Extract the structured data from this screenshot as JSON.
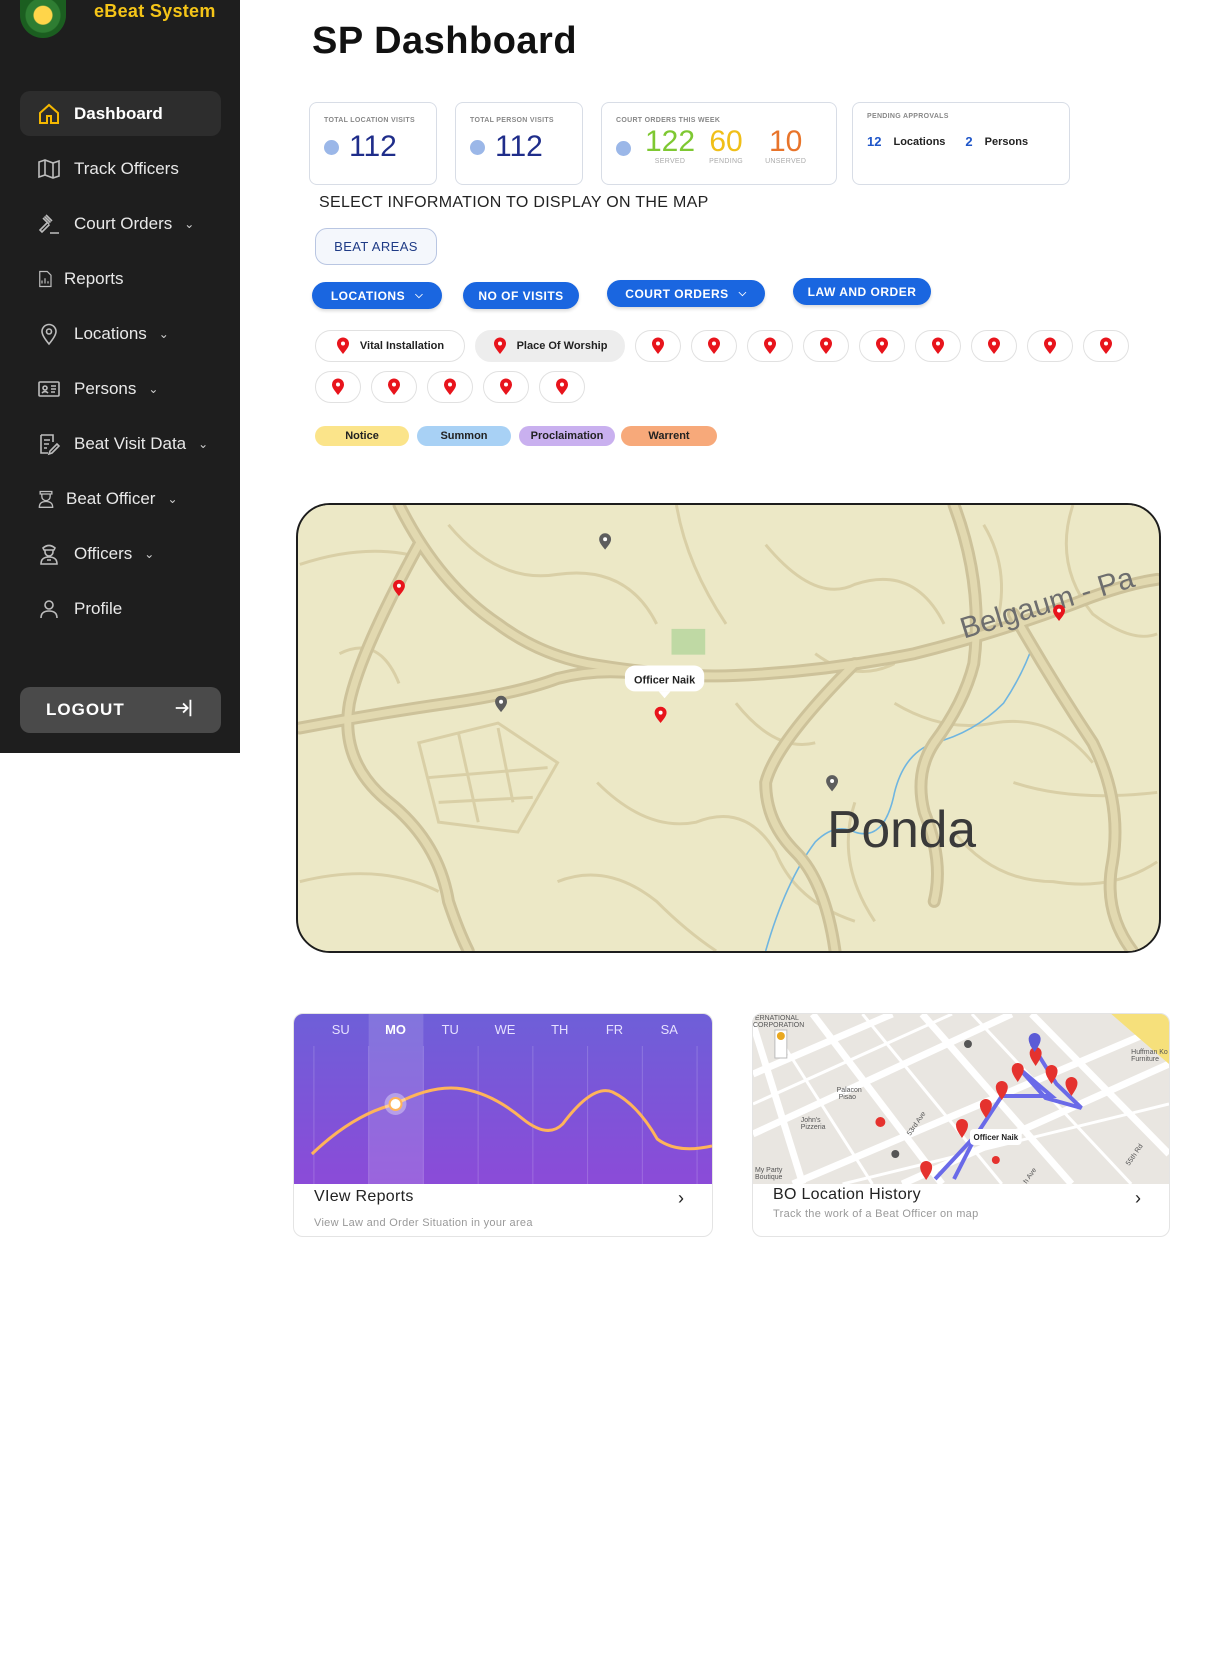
{
  "app": {
    "brand_name": "eBeat System"
  },
  "sidebar": {
    "items": [
      {
        "label": "Dashboard",
        "icon": "home-icon",
        "active": true,
        "has_submenu": false
      },
      {
        "label": "Track Officers",
        "icon": "map-icon",
        "has_submenu": false
      },
      {
        "label": "Court Orders",
        "icon": "gavel-icon",
        "has_submenu": true
      },
      {
        "label": "Reports",
        "icon": "report-icon",
        "has_submenu": false
      },
      {
        "label": "Locations",
        "icon": "location-pin-icon",
        "has_submenu": true
      },
      {
        "label": "Persons",
        "icon": "id-card-icon",
        "has_submenu": true
      },
      {
        "label": "Beat Visit Data",
        "icon": "edit-document-icon",
        "has_submenu": true
      },
      {
        "label": "Beat Officer",
        "icon": "officer-badge-icon",
        "has_submenu": true
      },
      {
        "label": "Officers",
        "icon": "police-officer-icon",
        "has_submenu": true
      },
      {
        "label": "Profile",
        "icon": "user-icon",
        "has_submenu": false
      }
    ],
    "logout_label": "LOGOUT"
  },
  "header": {
    "title": "SP Dashboard"
  },
  "stats": {
    "location_visits": {
      "label": "TOTAL LOCATION VISITS",
      "value": "112"
    },
    "person_visits": {
      "label": "TOTAL PERSON VISITS",
      "value": "112"
    },
    "court_orders": {
      "label": "COURT ORDERS THIS WEEK",
      "served": "122",
      "served_label": "SERVED",
      "pending": "60",
      "pending_label": "PENDING",
      "unserved": "10",
      "unserved_label": "UNSERVED"
    },
    "approvals": {
      "label": "PENDING APPROVALS",
      "locations_count": "12",
      "locations_label": "Locations",
      "persons_count": "2",
      "persons_label": "Persons"
    }
  },
  "map_filters": {
    "prompt": "SELECT INFORMATION TO DISPLAY ON THE MAP",
    "beat_areas": "BEAT AREAS",
    "locations": "LOCATIONS",
    "visits": "NO OF VISITS",
    "court_orders": "COURT ORDERS",
    "law_order": "LAW AND ORDER",
    "location_types": [
      "Vital Installation",
      "Place Of Worship"
    ],
    "order_types": [
      {
        "label": "Notice",
        "color": "#fbe48a"
      },
      {
        "label": "Summon",
        "color": "#a8d1f5"
      },
      {
        "label": "Proclaimation",
        "color": "#c9b0ef"
      },
      {
        "label": "Warrent",
        "color": "#f7a97a"
      }
    ]
  },
  "map": {
    "officer_label": "Officer Naik",
    "town_label": "Ponda",
    "road_label": "Belgaum - Pa"
  },
  "cards": {
    "reports": {
      "title": "VIew Reports",
      "subtitle": "View Law and Order Situation in your area",
      "days": [
        "SU",
        "MO",
        "TU",
        "WE",
        "TH",
        "FR",
        "SA"
      ]
    },
    "history": {
      "title": "BO Location History",
      "subtitle": "Track the work of a Beat Officer on map",
      "officer_label": "Officer Naik",
      "map_labels": [
        "ERNATIONAL",
        "CORPORATION",
        "Palacon",
        "Pisao",
        "John's",
        "Pizzeria",
        "My Party",
        "Boutique",
        "Huffman Ko",
        "Furniture",
        "53rd Ave",
        "55th Rd",
        "h Ave"
      ]
    }
  },
  "colors": {
    "primary": "#1a66e0",
    "sidebar": "#1e1e1e",
    "brand": "#f5c518",
    "pin": "#e8141c"
  }
}
